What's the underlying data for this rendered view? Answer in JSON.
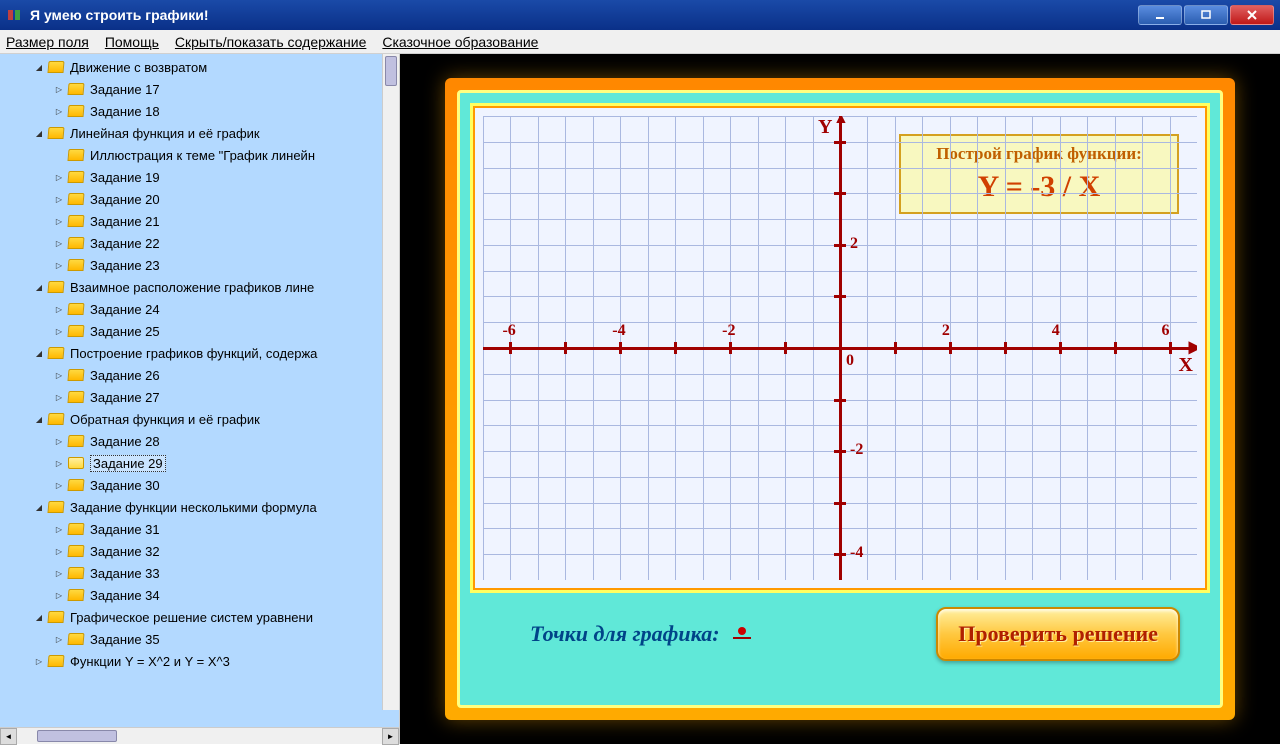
{
  "window": {
    "title": "Я умею строить графики!"
  },
  "menu": {
    "field_size": "Размер поля",
    "help": "Помощь",
    "toggle_toc": "Скрыть/показать содержание",
    "fairy_edu": "Сказочное образование"
  },
  "tree": [
    {
      "depth": 0,
      "expanded": true,
      "label": "Движение с возвратом"
    },
    {
      "depth": 1,
      "expanded": false,
      "label": "Задание 17"
    },
    {
      "depth": 1,
      "expanded": false,
      "label": "Задание 18"
    },
    {
      "depth": 0,
      "expanded": true,
      "label": "Линейная функция и её график"
    },
    {
      "depth": 1,
      "expanded": null,
      "label": "Иллюстрация к теме \"График линейн"
    },
    {
      "depth": 1,
      "expanded": false,
      "label": "Задание 19"
    },
    {
      "depth": 1,
      "expanded": false,
      "label": "Задание 20"
    },
    {
      "depth": 1,
      "expanded": false,
      "label": "Задание 21"
    },
    {
      "depth": 1,
      "expanded": false,
      "label": "Задание 22"
    },
    {
      "depth": 1,
      "expanded": false,
      "label": "Задание 23"
    },
    {
      "depth": 0,
      "expanded": true,
      "label": "Взаимное расположение графиков лине"
    },
    {
      "depth": 1,
      "expanded": false,
      "label": "Задание 24"
    },
    {
      "depth": 1,
      "expanded": false,
      "label": "Задание 25"
    },
    {
      "depth": 0,
      "expanded": true,
      "label": "Построение графиков функций, содержа"
    },
    {
      "depth": 1,
      "expanded": false,
      "label": "Задание 26"
    },
    {
      "depth": 1,
      "expanded": false,
      "label": "Задание 27"
    },
    {
      "depth": 0,
      "expanded": true,
      "label": "Обратная функция и её график"
    },
    {
      "depth": 1,
      "expanded": false,
      "label": "Задание 28"
    },
    {
      "depth": 1,
      "expanded": false,
      "label": "Задание 29",
      "selected": true,
      "open": true
    },
    {
      "depth": 1,
      "expanded": false,
      "label": "Задание 30"
    },
    {
      "depth": 0,
      "expanded": true,
      "label": "Задание функции несколькими формула"
    },
    {
      "depth": 1,
      "expanded": false,
      "label": "Задание 31"
    },
    {
      "depth": 1,
      "expanded": false,
      "label": "Задание 32"
    },
    {
      "depth": 1,
      "expanded": false,
      "label": "Задание 33"
    },
    {
      "depth": 1,
      "expanded": false,
      "label": "Задание 34"
    },
    {
      "depth": 0,
      "expanded": true,
      "label": "Графическое решение систем уравнени"
    },
    {
      "depth": 1,
      "expanded": false,
      "label": "Задание 35"
    },
    {
      "depth": 0,
      "expanded": false,
      "label": "Функции Y = X^2 и Y = X^3"
    }
  ],
  "task": {
    "prompt": "Построй график функции:",
    "formula": "Y = -3 / X",
    "x_label": "X",
    "y_label": "Y",
    "origin": "0",
    "xticks": [
      "-6",
      "-4",
      "-2",
      "2",
      "4",
      "6"
    ],
    "yticks_pos": [
      "2"
    ],
    "yticks_neg": [
      "-2",
      "-4"
    ]
  },
  "bottom": {
    "points_label": "Точки для графика:",
    "check_button": "Проверить решение"
  },
  "chart_data": {
    "type": "line",
    "title": "Построй график функции: Y = -3 / X",
    "xlabel": "X",
    "ylabel": "Y",
    "xlim": [
      -6.5,
      6.5
    ],
    "ylim": [
      -4.5,
      4.5
    ],
    "xticks": [
      -6,
      -4,
      -2,
      0,
      2,
      4,
      6
    ],
    "yticks": [
      -4,
      -2,
      0,
      2
    ],
    "grid": true,
    "series": []
  }
}
